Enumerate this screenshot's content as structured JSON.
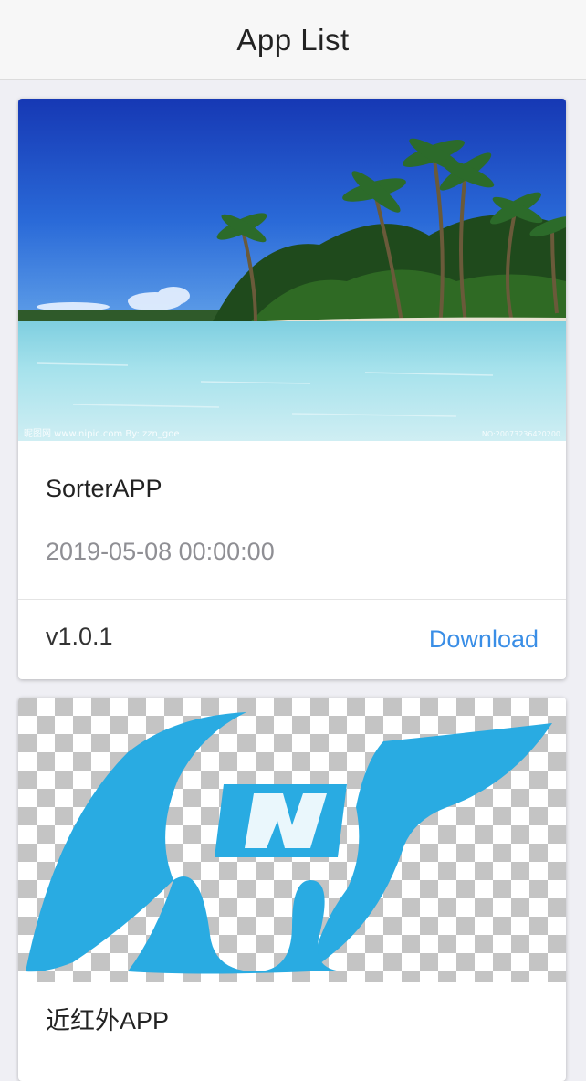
{
  "header": {
    "title": "App List"
  },
  "apps": [
    {
      "name": "SorterAPP",
      "date": "2019-05-08 00:00:00",
      "version": "v1.0.1",
      "download_label": "Download",
      "image_watermark_left": "昵图网 www.nipic.com   By: zzn_goe",
      "image_watermark_right": "NO:20073236420200"
    },
    {
      "name": "近红外APP"
    }
  ],
  "colors": {
    "accent": "#3a8ee6",
    "logo_blue": "#29abe2",
    "sky_top": "#1b3fb8",
    "sea": "#9fdbe8"
  }
}
